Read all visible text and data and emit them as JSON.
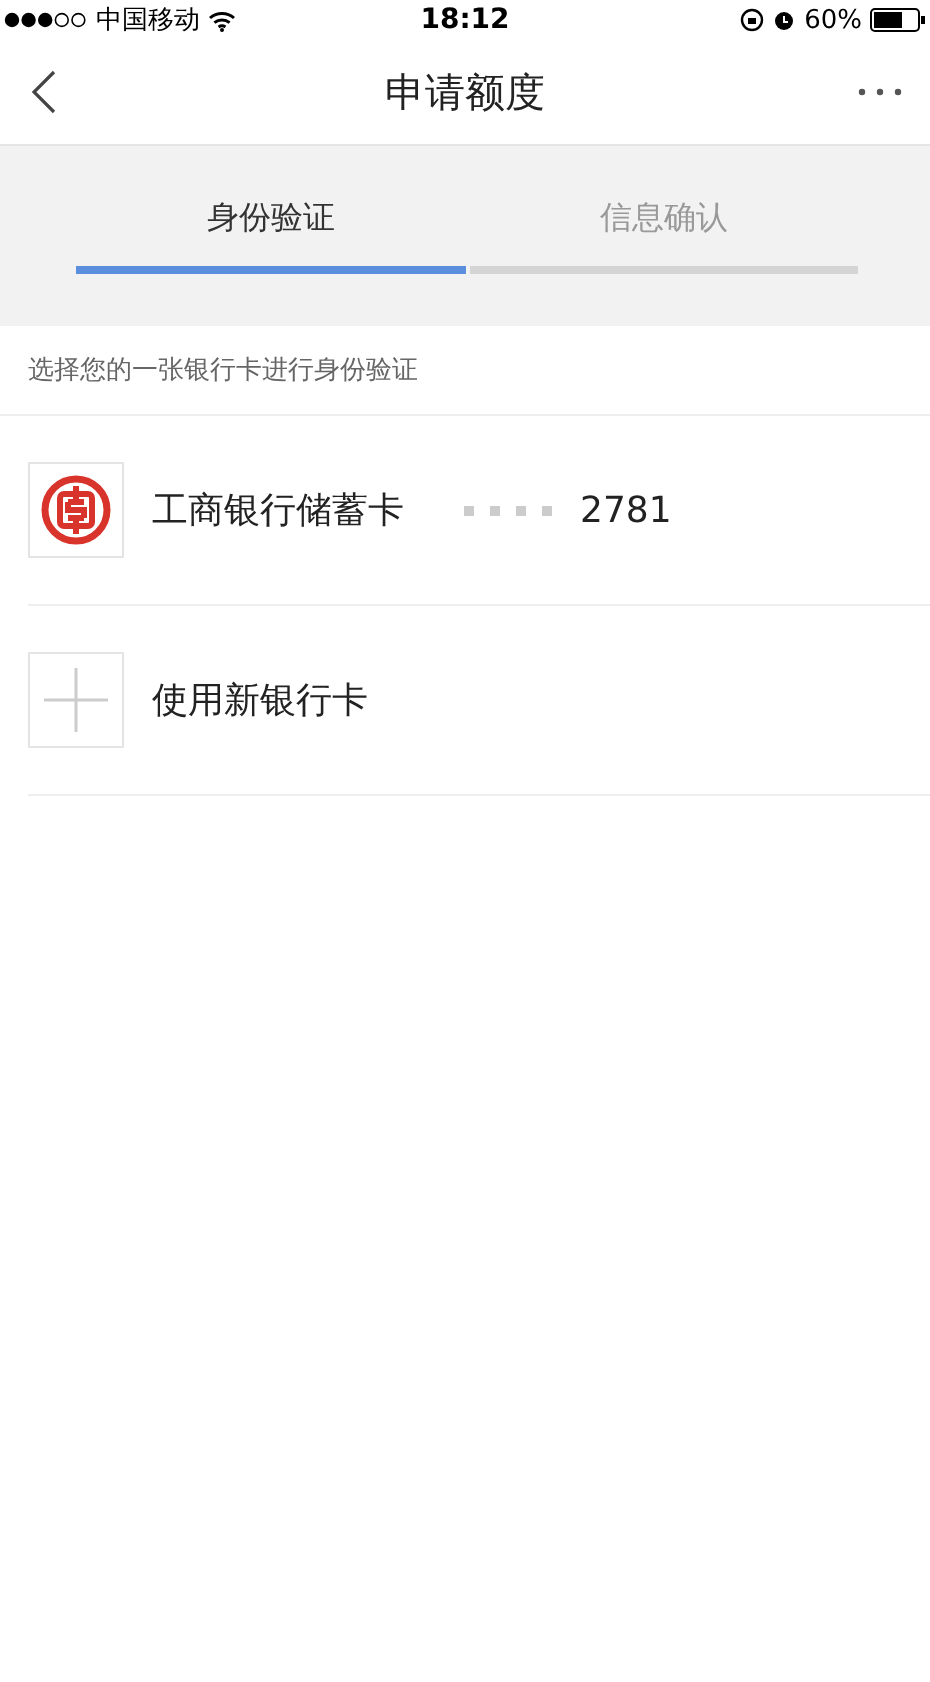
{
  "status_bar": {
    "carrier": "中国移动",
    "time": "18:12",
    "battery": "60%"
  },
  "nav": {
    "title": "申请额度"
  },
  "tabs": [
    {
      "label": "身份验证",
      "selected": true
    },
    {
      "label": "信息确认",
      "selected": false
    }
  ],
  "hint": "选择您的一张银行卡进行身份验证",
  "cards": [
    {
      "kind": "bank",
      "name": "工商银行储蓄卡",
      "last_digits": "2781"
    },
    {
      "kind": "add",
      "name": "使用新银行卡"
    }
  ]
}
